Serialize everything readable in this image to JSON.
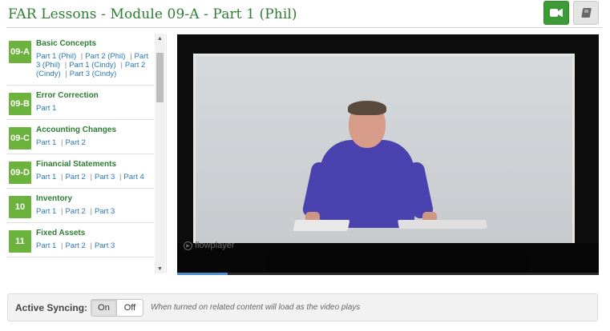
{
  "header": {
    "title": "FAR Lessons - Module 09-A - Part 1 (Phil)",
    "video_button_icon": "video-camera-icon",
    "notes_button_icon": "book-icon"
  },
  "colors": {
    "accent_green": "#3d9b35",
    "badge_green": "#6cb33e",
    "title_green": "#2e7d32",
    "link_blue": "#2a78b8"
  },
  "modules": [
    {
      "badge": "09-A",
      "title": "Basic Concepts",
      "links": [
        "Part 1 (Phil)",
        "Part 2 (Phil)",
        "Part 3 (Phil)",
        "Part 1 (Cindy)",
        "Part 2 (Cindy)",
        "Part 3 (Cindy)"
      ]
    },
    {
      "badge": "09-B",
      "title": "Error Correction",
      "links": [
        "Part 1"
      ]
    },
    {
      "badge": "09-C",
      "title": "Accounting Changes",
      "links": [
        "Part 1",
        "Part 2"
      ]
    },
    {
      "badge": "09-D",
      "title": "Financial Statements",
      "links": [
        "Part 1",
        "Part 2",
        "Part 3",
        "Part 4"
      ]
    },
    {
      "badge": "10",
      "title": "Inventory",
      "links": [
        "Part 1",
        "Part 2",
        "Part 3"
      ]
    },
    {
      "badge": "11",
      "title": "Fixed Assets",
      "links": [
        "Part 1",
        "Part 2",
        "Part 3"
      ]
    }
  ],
  "video": {
    "watermark": "flowplayer",
    "progress_fraction": 0.12
  },
  "sync": {
    "label": "Active Syncing:",
    "on_label": "On",
    "off_label": "Off",
    "selected": "On",
    "note": "When turned on related content will load as the video plays"
  }
}
